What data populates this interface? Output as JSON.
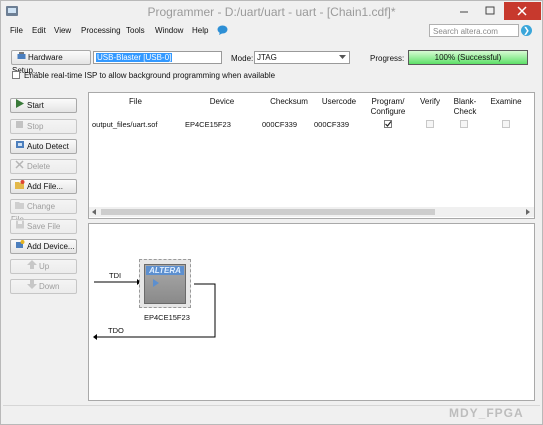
{
  "window": {
    "title": "Programmer - D:/uart/uart - uart - [Chain1.cdf]*"
  },
  "menu": [
    "File",
    "Edit",
    "View",
    "Processing",
    "Tools",
    "Window",
    "Help"
  ],
  "search": {
    "placeholder": "Search altera.com"
  },
  "toolbar": {
    "hardware_setup_label": "Hardware Setup...",
    "hardware_value": "USB-Blaster [USB-0]",
    "mode_label": "Mode:",
    "mode_value": "JTAG",
    "progress_label": "Progress:",
    "progress_value": "100% (Successful)",
    "progress_fraction": 1.0,
    "isp_label": "Enable real-time ISP to allow background programming when available"
  },
  "side_buttons": [
    {
      "label": "Start",
      "icon": "start-icon",
      "enabled": true
    },
    {
      "label": "Stop",
      "icon": "stop-icon",
      "enabled": false
    },
    {
      "label": "Auto Detect",
      "icon": "auto-detect-icon",
      "enabled": true
    },
    {
      "label": "Delete",
      "icon": "delete-icon",
      "enabled": false
    },
    {
      "label": "Add File...",
      "icon": "add-file-icon",
      "enabled": true
    },
    {
      "label": "Change File...",
      "icon": "change-file-icon",
      "enabled": false
    },
    {
      "label": "Save File",
      "icon": "save-file-icon",
      "enabled": false
    },
    {
      "label": "Add Device...",
      "icon": "add-device-icon",
      "enabled": true
    },
    {
      "label": "Up",
      "icon": "up-icon",
      "enabled": false
    },
    {
      "label": "Down",
      "icon": "down-icon",
      "enabled": false
    }
  ],
  "table": {
    "headers": {
      "file": "File",
      "device": "Device",
      "checksum": "Checksum",
      "usercode": "Usercode",
      "program1": "Program/",
      "program2": "Configure",
      "verify": "Verify",
      "blank1": "Blank-",
      "blank2": "Check",
      "examine": "Examine"
    },
    "rows": [
      {
        "file": "output_files/uart.sof",
        "device": "EP4CE15F23",
        "checksum": "000CF339",
        "usercode": "000CF339",
        "program": true,
        "verify": false,
        "blank_check": false,
        "examine": false
      }
    ]
  },
  "chain": {
    "tdi": "TDI",
    "tdo": "TDO",
    "chip_logo": "ALTERA",
    "chip_name": "EP4CE15F23"
  },
  "watermark": "MDY_FPGA",
  "colors": {
    "progress_green": "#5de068",
    "selection_blue": "#3399ff",
    "chip_logo_blue": "#5c8fcf"
  }
}
